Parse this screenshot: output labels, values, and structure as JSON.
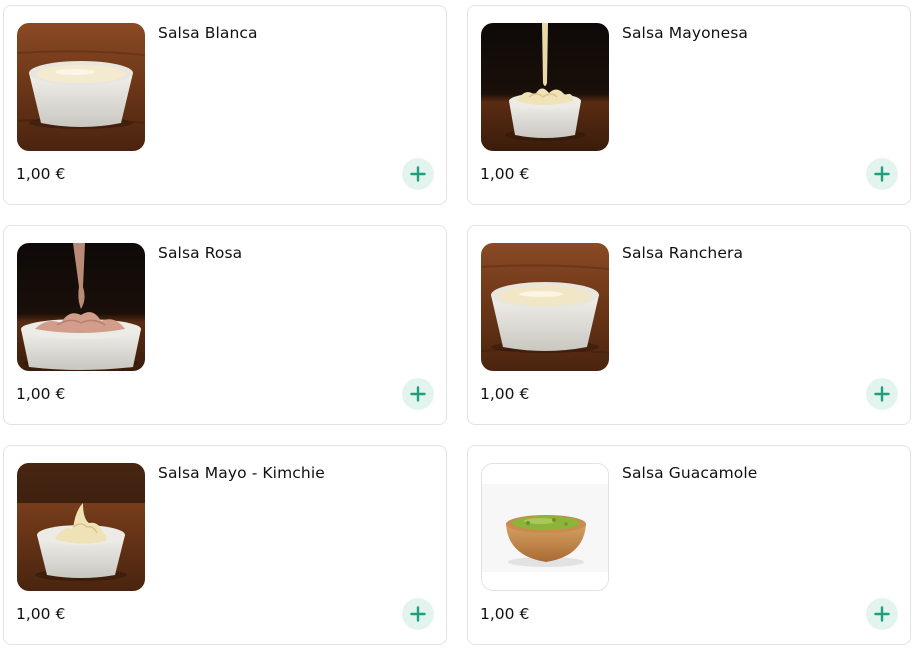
{
  "colors": {
    "accent": "#1f9e7d",
    "add_button_bg": "#e3f4ef",
    "card_border": "#e3e3e3"
  },
  "products": [
    {
      "name": "Salsa Blanca",
      "price": "1,00 €",
      "image": "white-sauce-bowl",
      "add_icon": "plus-icon"
    },
    {
      "name": "Salsa Mayonesa",
      "price": "1,00 €",
      "image": "mayonnaise-pour-bowl",
      "add_icon": "plus-icon"
    },
    {
      "name": "Salsa Rosa",
      "price": "1,00 €",
      "image": "pink-sauce-pour-bowl",
      "add_icon": "plus-icon"
    },
    {
      "name": "Salsa Ranchera",
      "price": "1,00 €",
      "image": "ranch-sauce-bowl",
      "add_icon": "plus-icon"
    },
    {
      "name": "Salsa Mayo - Kimchie",
      "price": "1,00 €",
      "image": "mayo-kimchi-swirl-bowl",
      "add_icon": "plus-icon"
    },
    {
      "name": "Salsa Guacamole",
      "price": "1,00 €",
      "image": "guacamole-wooden-bowl",
      "add_icon": "plus-icon"
    }
  ]
}
